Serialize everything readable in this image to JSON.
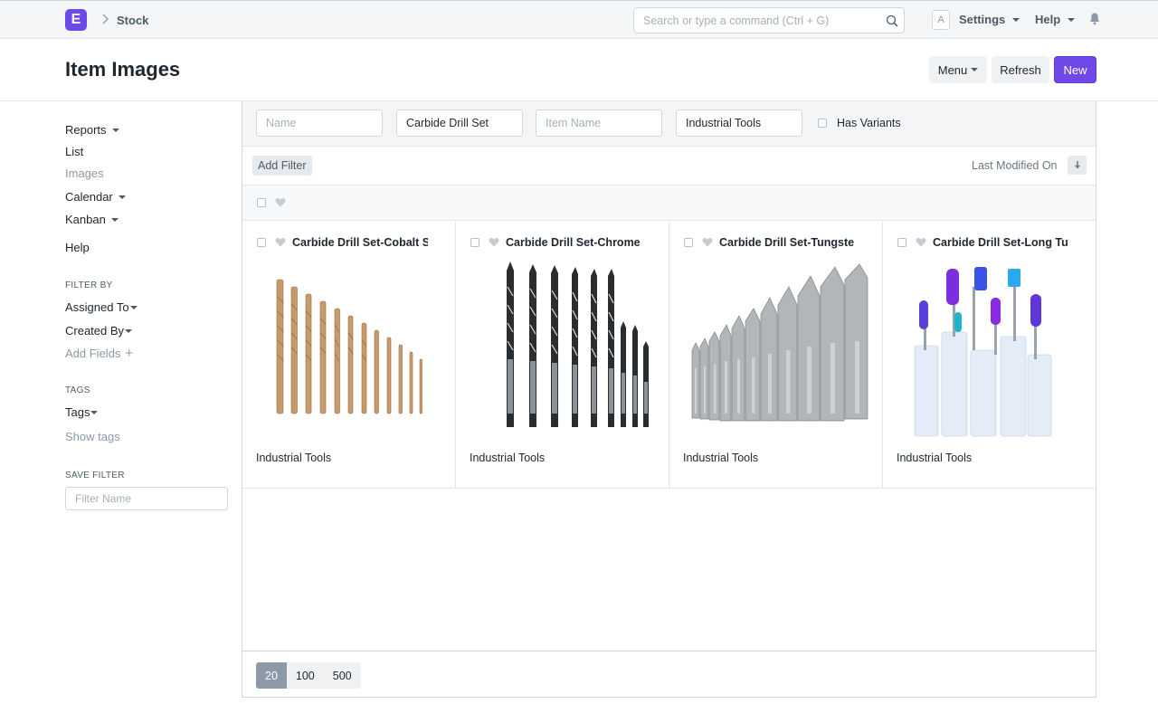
{
  "navbar": {
    "logo_letter": "E",
    "breadcrumb": "Stock",
    "search_placeholder": "Search or type a command (Ctrl + G)",
    "avatar_letter": "A",
    "settings_label": "Settings",
    "help_label": "Help"
  },
  "header": {
    "title": "Item Images",
    "menu_label": "Menu",
    "refresh_label": "Refresh",
    "new_label": "New"
  },
  "sidebar": {
    "reports": "Reports",
    "list": "List",
    "images": "Images",
    "calendar": "Calendar",
    "kanban": "Kanban",
    "help": "Help",
    "filter_by_heading": "FILTER BY",
    "assigned_to": "Assigned To",
    "created_by": "Created By",
    "add_fields": "Add Fields",
    "tags_heading": "TAGS",
    "tags": "Tags",
    "show_tags": "Show tags",
    "save_filter_heading": "SAVE FILTER",
    "filter_name_placeholder": "Filter Name"
  },
  "filters": {
    "name_placeholder": "Name",
    "item_group_value": "Carbide Drill Set",
    "item_name_placeholder": "Item Name",
    "brand_value": "Industrial Tools",
    "has_variants_label": "Has Variants",
    "add_filter": "Add Filter",
    "sort_label": "Last Modified On"
  },
  "cards": [
    {
      "title": "Carbide Drill Set-Cobalt Steel",
      "group": "Industrial Tools",
      "image": "cobalt-drill-bits"
    },
    {
      "title": "Carbide Drill Set-Chrome",
      "group": "Industrial Tools",
      "image": "chrome-drill-bits"
    },
    {
      "title": "Carbide Drill Set-Tungsten",
      "group": "Industrial Tools",
      "image": "tungsten-drill-bits"
    },
    {
      "title": "Carbide Drill Set-Long Tube",
      "group": "Industrial Tools",
      "image": "nail-drill-bits"
    }
  ],
  "paging": {
    "options": [
      "20",
      "100",
      "500"
    ],
    "selected": "20"
  },
  "colors": {
    "primary": "#7048e8",
    "navbar_bg": "#f4f5f6",
    "cobalt_bit": "#c99a6b",
    "chrome_bit": "#2a2d30",
    "tungsten_bit": "#b3b6b8"
  }
}
